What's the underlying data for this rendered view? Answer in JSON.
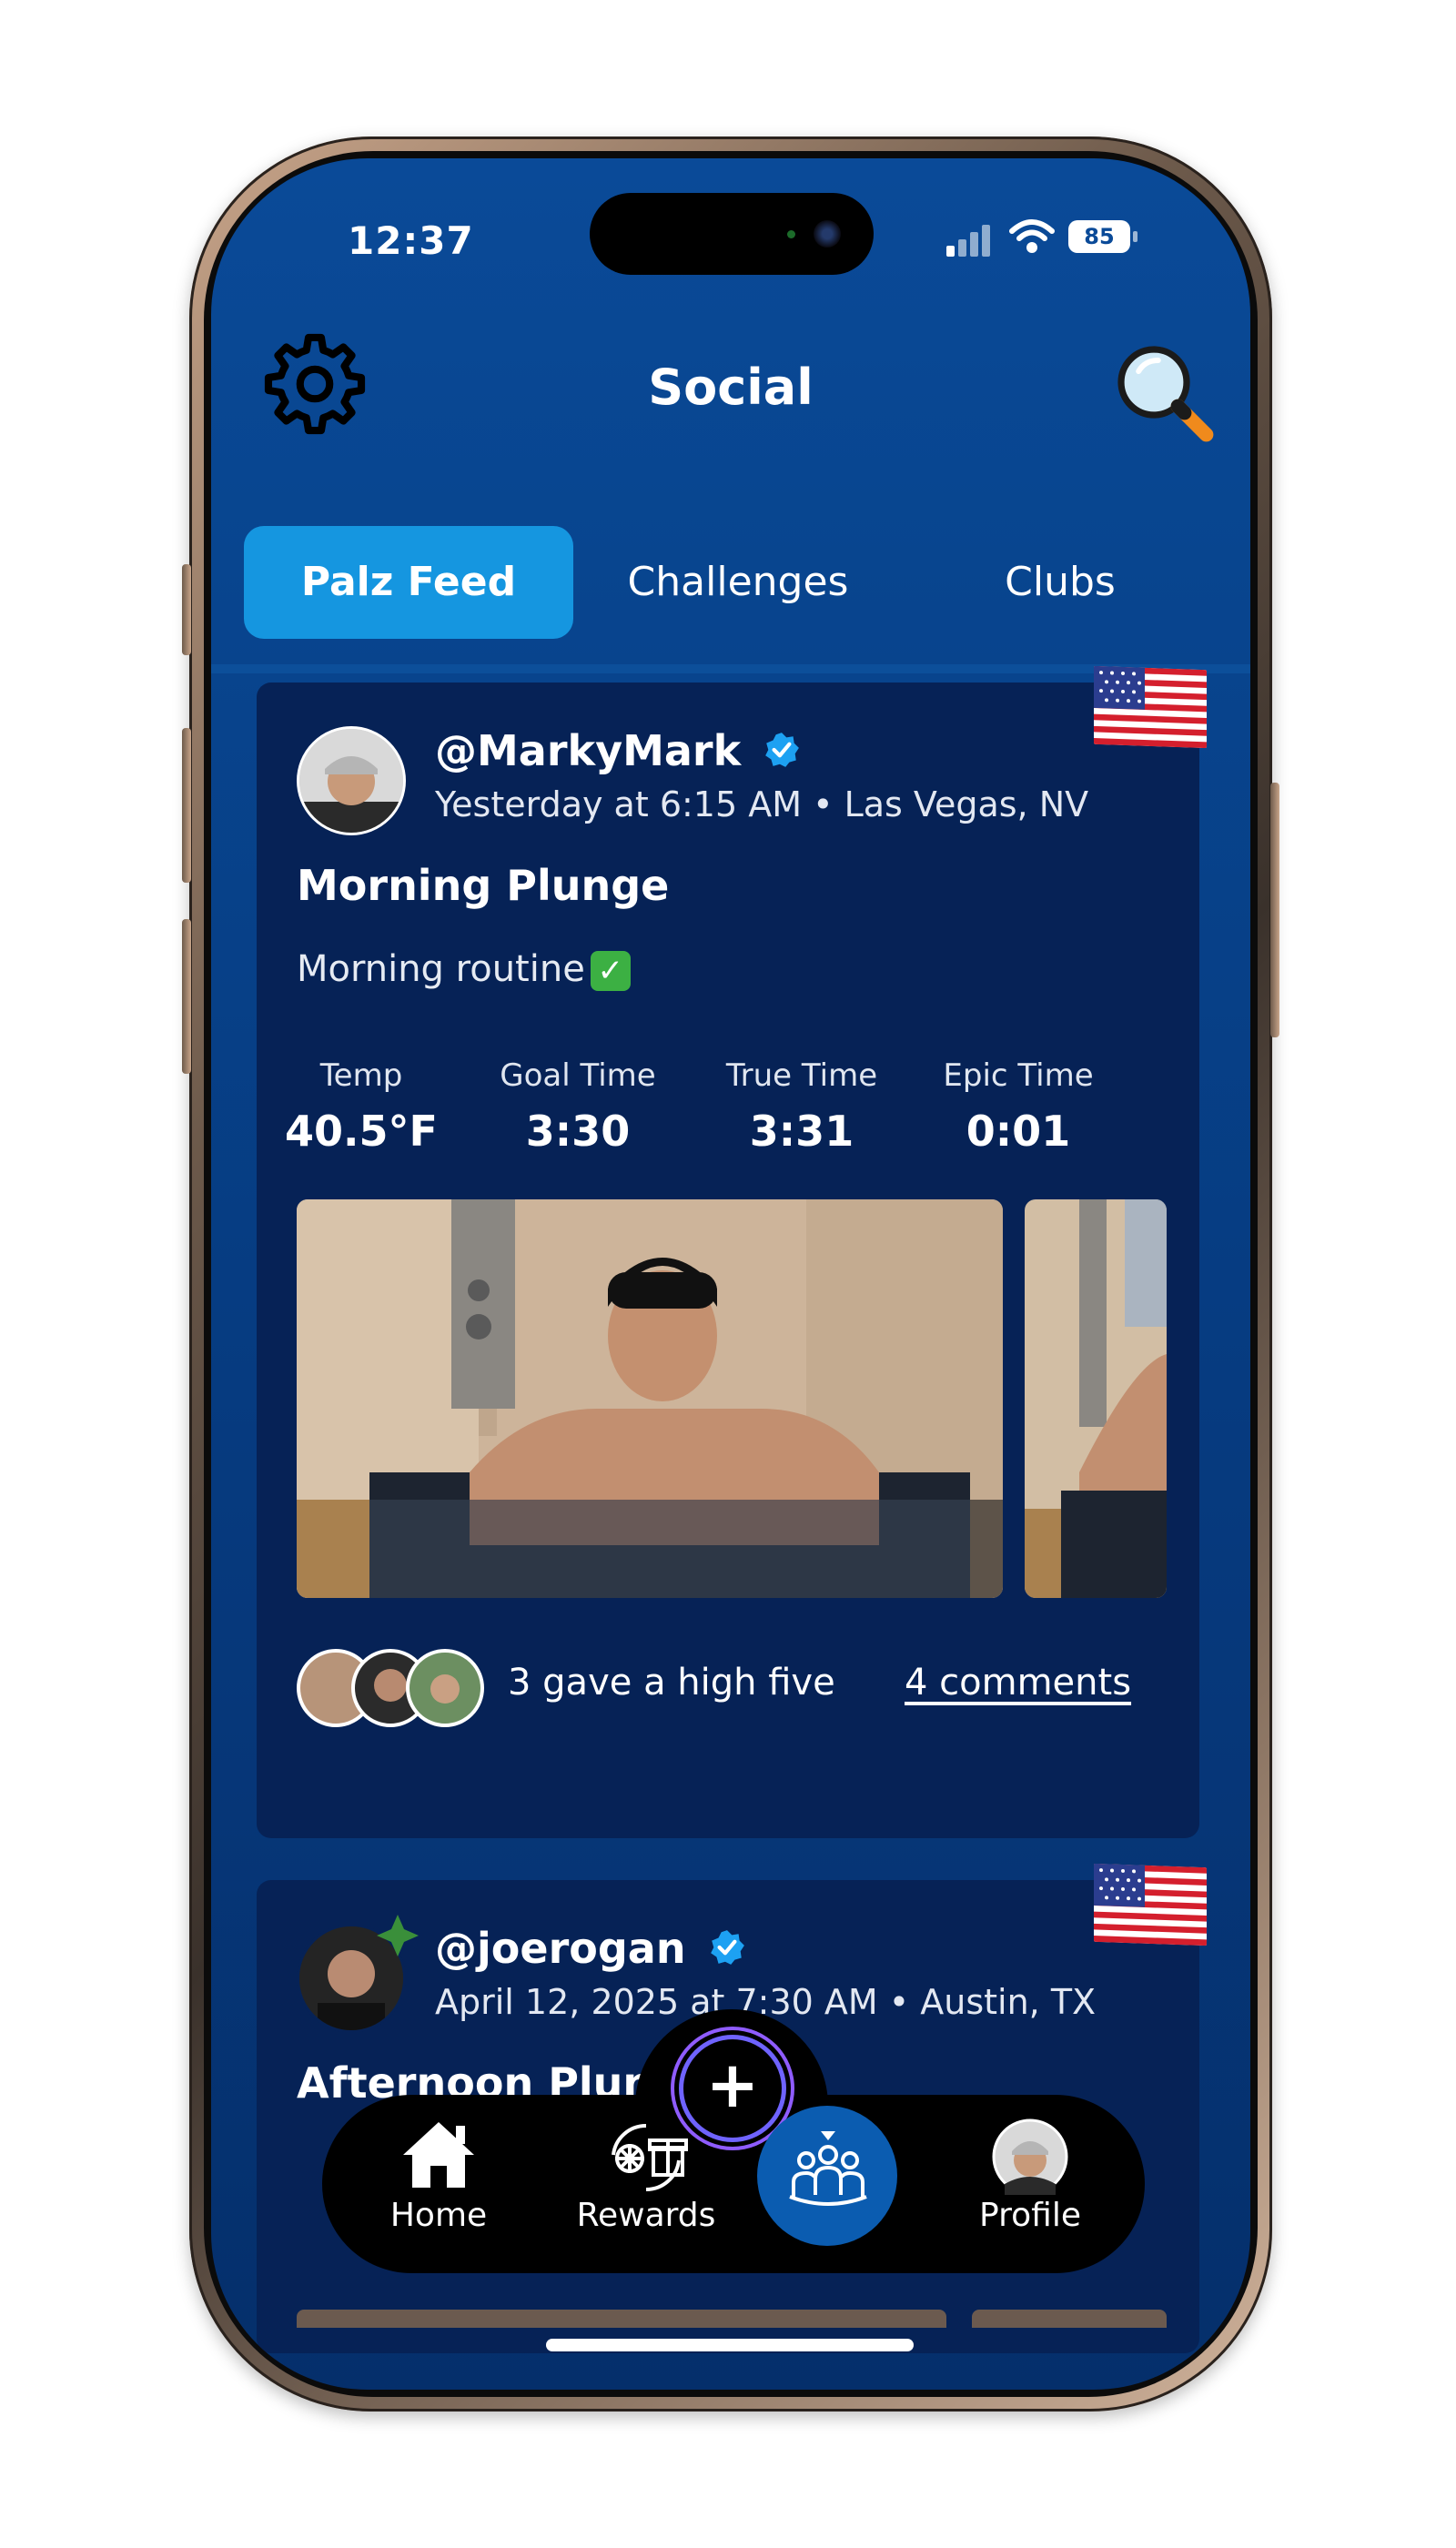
{
  "status_bar": {
    "time": "12:37",
    "battery": "85"
  },
  "header": {
    "title": "Social",
    "settings_icon": "gear-icon",
    "search_icon": "search-icon"
  },
  "tabs": [
    {
      "label": "Palz Feed",
      "active": true
    },
    {
      "label": "Challenges",
      "active": false
    },
    {
      "label": "Clubs",
      "active": false
    }
  ],
  "posts": [
    {
      "username": "@MarkyMark",
      "verified": true,
      "meta": "Yesterday at 6:15 AM • Las Vegas, NV",
      "title": "Morning Plunge",
      "text": "Morning routine",
      "stats": [
        {
          "label": "Temp",
          "value": "40.5°F"
        },
        {
          "label": "Goal Time",
          "value": "3:30"
        },
        {
          "label": "True Time",
          "value": "3:31"
        },
        {
          "label": "Epic Time",
          "value": "0:01"
        }
      ],
      "high_five_text": "3 gave a high five",
      "comments_label": "4 comments"
    },
    {
      "username": "@joerogan",
      "verified": true,
      "meta": "April 12, 2025 at 7:30 AM • Austin, TX",
      "title": "Afternoon Plunge"
    }
  ],
  "tabbar": {
    "home": "Home",
    "rewards": "Rewards",
    "profile": "Profile",
    "add_icon": "plus-icon",
    "social_icon": "group-icon"
  },
  "colors": {
    "accent": "#1596e0",
    "background": "#063b80",
    "card": "#062256"
  }
}
